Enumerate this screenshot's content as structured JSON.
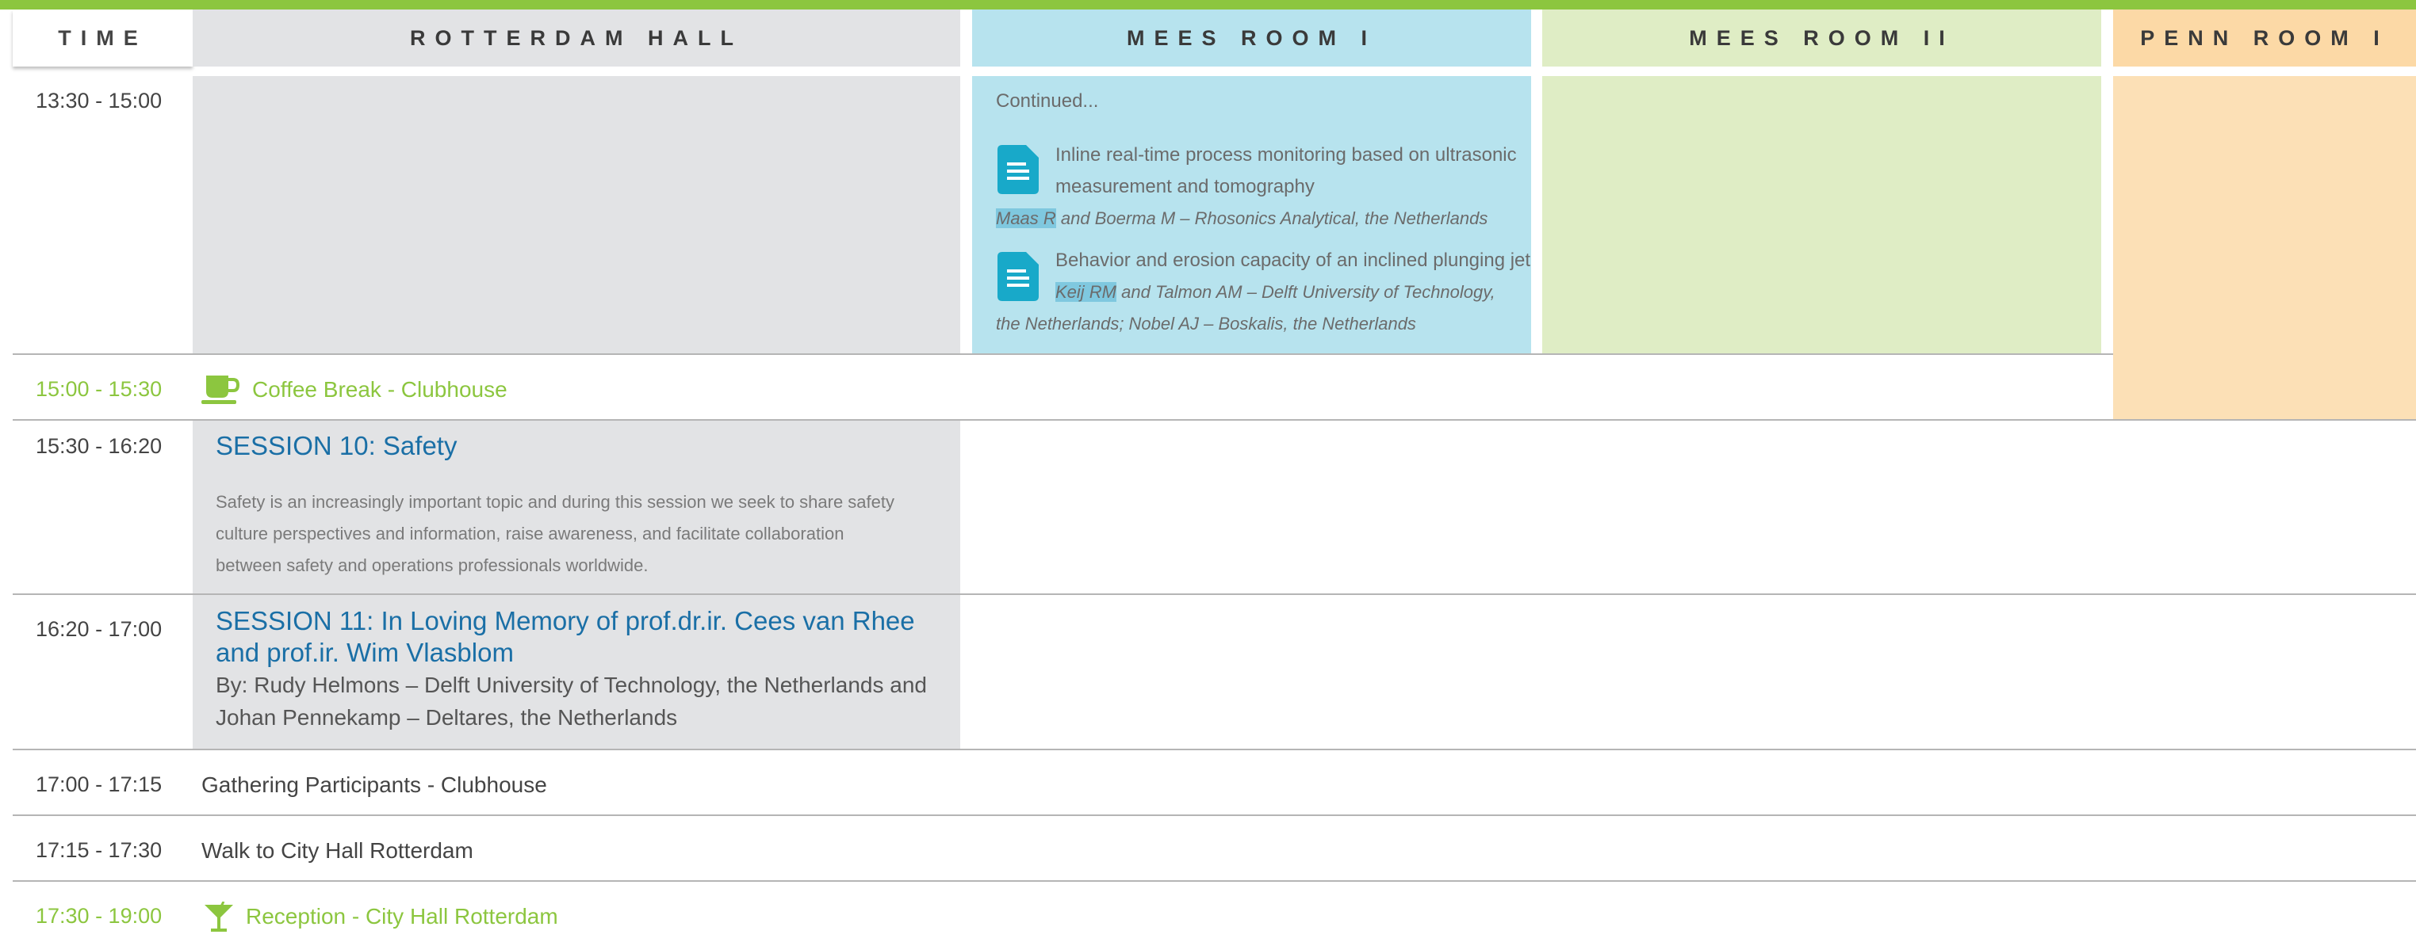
{
  "columns": {
    "time": "TIME",
    "rotterdam_hall": "ROTTERDAM HALL",
    "mees_room_1": "MEES ROOM I",
    "mees_room_2": "MEES ROOM II",
    "penn_room_1": "PENN ROOM I"
  },
  "colors": {
    "top_bar": "#8cc63f",
    "rotterdam_hall": "#e2e3e5",
    "mees_room_1": "#b7e3ee",
    "mees_room_2": "#dfedc5",
    "penn_room_1": "#fcd9a6",
    "accent_green": "#8cc63f",
    "session_blue": "#1a6fa6",
    "doc_icon": "#18a9c9"
  },
  "rows": {
    "r1": {
      "time": "13:30 - 15:00",
      "continued": "Continued...",
      "paper1": {
        "title_line1": "Inline real-time process monitoring based on ultrasonic",
        "title_line2": "measurement and tomography",
        "author_highlight": "Maas R",
        "author_rest": " and Boerma M – Rhosonics Analytical, the Netherlands"
      },
      "paper2": {
        "title": "Behavior and erosion capacity of an inclined plunging jet",
        "author_highlight": "Keij RM",
        "author_rest": " and Talmon AM – Delft University of Technology,",
        "author_line2": "the Netherlands; Nobel AJ – Boskalis, the Netherlands"
      }
    },
    "r2": {
      "time": "15:00 - 15:30",
      "label": "Coffee Break - Clubhouse",
      "icon": "coffee-cup-icon"
    },
    "r3": {
      "time": "15:30 - 16:20",
      "title": "SESSION 10: Safety",
      "desc_line1": "Safety is an increasingly important topic and during this session we seek to share safety",
      "desc_line2": "culture perspectives and information, raise awareness, and facilitate collaboration",
      "desc_line3": "between safety and operations professionals worldwide."
    },
    "r4": {
      "time": "16:20 - 17:00",
      "title_line1": "SESSION 11: In Loving Memory of prof.dr.ir. Cees van Rhee",
      "title_line2": "and prof.ir. Wim Vlasblom",
      "by_line1": "By: Rudy Helmons – Delft University of Technology, the Netherlands and",
      "by_line2": "Johan Pennekamp – Deltares, the Netherlands"
    },
    "r5": {
      "time": "17:00 - 17:15",
      "label": "Gathering Participants - Clubhouse"
    },
    "r6": {
      "time": "17:15 - 17:30",
      "label": "Walk to City Hall Rotterdam"
    },
    "r7": {
      "time": "17:30 - 19:00",
      "label": "Reception - City Hall Rotterdam",
      "icon": "cocktail-glass-icon"
    }
  }
}
